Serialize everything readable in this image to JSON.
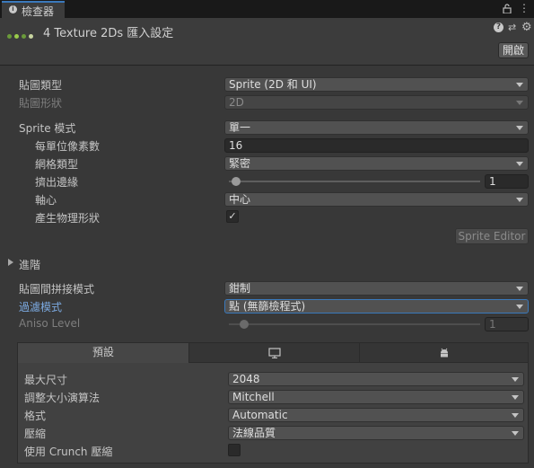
{
  "window": {
    "tab_label": "檢查器",
    "tab_icon": "info-icon"
  },
  "header": {
    "title": "4 Texture 2Ds 匯入設定",
    "open_button": "開啟",
    "icons": [
      "help-icon",
      "preset-icon",
      "settings-icon"
    ]
  },
  "rows": {
    "texture_type": {
      "label": "貼圖類型",
      "value": "Sprite (2D 和 UI)"
    },
    "texture_shape": {
      "label": "貼圖形狀",
      "value": "2D"
    },
    "sprite_mode": {
      "label": "Sprite 模式",
      "value": "單一"
    },
    "pixels_per_unit": {
      "label": "每單位像素數",
      "value": "16"
    },
    "mesh_type": {
      "label": "網格類型",
      "value": "緊密"
    },
    "extrude_edges": {
      "label": "擠出邊緣",
      "value": "1",
      "slider_fraction": 0.03
    },
    "pivot": {
      "label": "軸心",
      "value": "中心"
    },
    "physics_shape": {
      "label": "產生物理形狀",
      "checked": "✓"
    },
    "sprite_editor_button": "Sprite Editor",
    "advanced": {
      "label": "進階"
    },
    "wrap_mode": {
      "label": "貼圖間拼接模式",
      "value": "鉗制"
    },
    "filter_mode": {
      "label": "過濾模式",
      "value": "點 (無篩檢程式)"
    },
    "aniso_level": {
      "label": "Aniso Level",
      "value": "1",
      "slider_fraction": 0.06
    }
  },
  "platform": {
    "tabs": [
      {
        "label": "預設",
        "icon": null
      },
      {
        "label": "",
        "icon": "monitor-icon"
      },
      {
        "label": "",
        "icon": "android-icon"
      }
    ],
    "max_size": {
      "label": "最大尺寸",
      "value": "2048"
    },
    "resize_algorithm": {
      "label": "調整大小演算法",
      "value": "Mitchell"
    },
    "format": {
      "label": "格式",
      "value": "Automatic"
    },
    "compression": {
      "label": "壓縮",
      "value": "法線品質"
    },
    "crunch": {
      "label": "使用 Crunch 壓縮",
      "checked": ""
    }
  },
  "colors": {
    "accent": "#3a79bb",
    "background": "#383838",
    "link_label": "#7ba9e0"
  }
}
